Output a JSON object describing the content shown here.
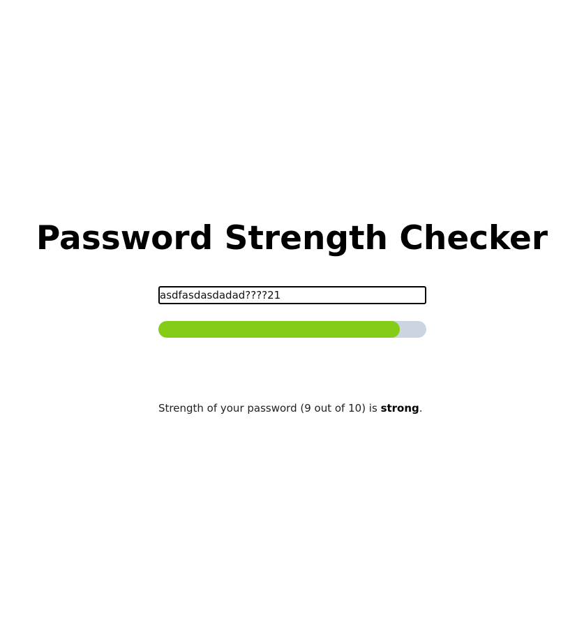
{
  "page": {
    "title": "Password Strength Checker"
  },
  "password": {
    "value": "asdfasdasdadad????21",
    "placeholder": ""
  },
  "meter": {
    "score": 9,
    "max": 10,
    "fill_color": "#84cc16",
    "track_color": "#cbd5e1"
  },
  "result": {
    "prefix": "Strength of your password (",
    "score_text": "9",
    "middle": " out of ",
    "max_text": "10",
    "suffix_before_level": ") is ",
    "level": "strong",
    "end": "."
  }
}
